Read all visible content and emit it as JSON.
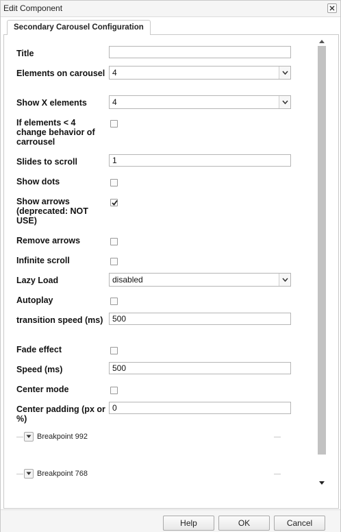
{
  "window": {
    "title": "Edit Component"
  },
  "tabs": [
    {
      "label": "Secondary Carousel Configuration"
    }
  ],
  "form": {
    "title": {
      "label": "Title",
      "value": ""
    },
    "elements_on_carousel": {
      "label": "Elements on carousel",
      "value": "4"
    },
    "show_x_elements": {
      "label": "Show X elements",
      "value": "4"
    },
    "change_behavior": {
      "label": "If elements < 4 change behavior of carrousel",
      "checked": false
    },
    "slides_to_scroll": {
      "label": "Slides to scroll",
      "value": "1"
    },
    "show_dots": {
      "label": "Show dots",
      "checked": false
    },
    "show_arrows": {
      "label": "Show arrows (deprecated: NOT USE)",
      "checked": true
    },
    "remove_arrows": {
      "label": "Remove arrows",
      "checked": false
    },
    "infinite_scroll": {
      "label": "Infinite scroll",
      "checked": false
    },
    "lazy_load": {
      "label": "Lazy Load",
      "value": "disabled"
    },
    "autoplay": {
      "label": "Autoplay",
      "checked": false
    },
    "transition_speed": {
      "label": "transition speed (ms)",
      "value": "500"
    },
    "fade_effect": {
      "label": "Fade effect",
      "checked": false
    },
    "speed": {
      "label": "Speed (ms)",
      "value": "500"
    },
    "center_mode": {
      "label": "Center mode",
      "checked": false
    },
    "center_padding": {
      "label": "Center padding (px or %)",
      "value": "0"
    }
  },
  "breakpoints": [
    {
      "label": "Breakpoint 992"
    },
    {
      "label": "Breakpoint 768"
    }
  ],
  "footer": {
    "help_label": "Help",
    "ok_label": "OK",
    "cancel_label": "Cancel"
  },
  "icons": {
    "close": "close-icon",
    "dropdown": "chevron-down-icon",
    "expand": "chevron-down-icon",
    "check": "checkmark-icon"
  }
}
